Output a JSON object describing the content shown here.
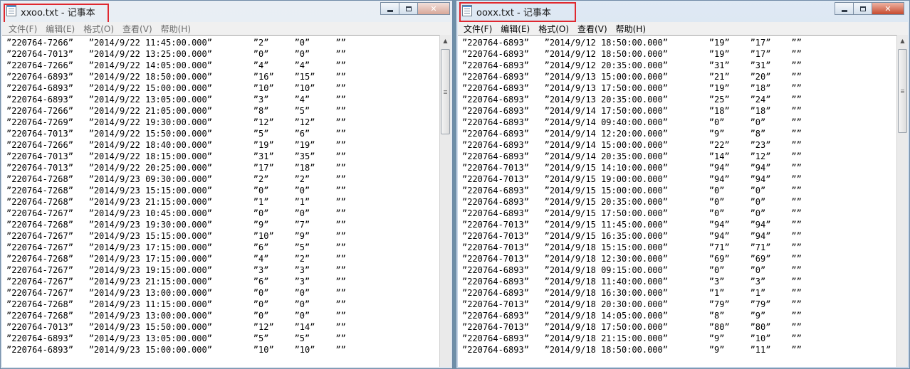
{
  "windows": [
    {
      "title": "xxoo.txt - 记事本",
      "menus": [
        "文件(F)",
        "编辑(E)",
        "格式(O)",
        "查看(V)",
        "帮助(H)"
      ],
      "rows": [
        [
          "220764-7266",
          "2014/9/22 11:45:00.000",
          "2",
          "0",
          ""
        ],
        [
          "220764-7013",
          "2014/9/22 13:25:00.000",
          "0",
          "0",
          ""
        ],
        [
          "220764-7266",
          "2014/9/22 14:05:00.000",
          "4",
          "4",
          ""
        ],
        [
          "220764-6893",
          "2014/9/22 18:50:00.000",
          "16",
          "15",
          ""
        ],
        [
          "220764-6893",
          "2014/9/22 15:00:00.000",
          "10",
          "10",
          ""
        ],
        [
          "220764-6893",
          "2014/9/22 13:05:00.000",
          "3",
          "4",
          ""
        ],
        [
          "220764-7266",
          "2014/9/22 21:05:00.000",
          "8",
          "5",
          ""
        ],
        [
          "220764-7269",
          "2014/9/22 19:30:00.000",
          "12",
          "12",
          ""
        ],
        [
          "220764-7013",
          "2014/9/22 15:50:00.000",
          "5",
          "6",
          ""
        ],
        [
          "220764-7266",
          "2014/9/22 18:40:00.000",
          "19",
          "19",
          ""
        ],
        [
          "220764-7013",
          "2014/9/22 18:15:00.000",
          "31",
          "35",
          ""
        ],
        [
          "220764-7013",
          "2014/9/22 20:25:00.000",
          "17",
          "18",
          ""
        ],
        [
          "220764-7268",
          "2014/9/23 09:30:00.000",
          "2",
          "2",
          ""
        ],
        [
          "220764-7268",
          "2014/9/23 15:15:00.000",
          "0",
          "0",
          ""
        ],
        [
          "220764-7268",
          "2014/9/23 21:15:00.000",
          "1",
          "1",
          ""
        ],
        [
          "220764-7267",
          "2014/9/23 10:45:00.000",
          "0",
          "0",
          ""
        ],
        [
          "220764-7268",
          "2014/9/23 19:30:00.000",
          "9",
          "7",
          ""
        ],
        [
          "220764-7267",
          "2014/9/23 15:15:00.000",
          "10",
          "9",
          ""
        ],
        [
          "220764-7267",
          "2014/9/23 17:15:00.000",
          "6",
          "5",
          ""
        ],
        [
          "220764-7268",
          "2014/9/23 17:15:00.000",
          "4",
          "2",
          ""
        ],
        [
          "220764-7267",
          "2014/9/23 19:15:00.000",
          "3",
          "3",
          ""
        ],
        [
          "220764-7267",
          "2014/9/23 21:15:00.000",
          "6",
          "3",
          ""
        ],
        [
          "220764-7267",
          "2014/9/23 13:00:00.000",
          "0",
          "0",
          ""
        ],
        [
          "220764-7268",
          "2014/9/23 11:15:00.000",
          "0",
          "0",
          ""
        ],
        [
          "220764-7268",
          "2014/9/23 13:00:00.000",
          "0",
          "0",
          ""
        ],
        [
          "220764-7013",
          "2014/9/23 15:50:00.000",
          "12",
          "14",
          ""
        ],
        [
          "220764-6893",
          "2014/9/23 13:05:00.000",
          "5",
          "5",
          ""
        ],
        [
          "220764-6893",
          "2014/9/23 15:00:00.000",
          "10",
          "10",
          ""
        ]
      ]
    },
    {
      "title": "ooxx.txt - 记事本",
      "menus": [
        "文件(F)",
        "编辑(E)",
        "格式(O)",
        "查看(V)",
        "帮助(H)"
      ],
      "rows": [
        [
          "220764-6893",
          "2014/9/12 18:50:00.000",
          "19",
          "17",
          ""
        ],
        [
          "220764-6893",
          "2014/9/12 18:50:00.000",
          "19",
          "17",
          ""
        ],
        [
          "220764-6893",
          "2014/9/12 20:35:00.000",
          "31",
          "31",
          ""
        ],
        [
          "220764-6893",
          "2014/9/13 15:00:00.000",
          "21",
          "20",
          ""
        ],
        [
          "220764-6893",
          "2014/9/13 17:50:00.000",
          "19",
          "18",
          ""
        ],
        [
          "220764-6893",
          "2014/9/13 20:35:00.000",
          "25",
          "24",
          ""
        ],
        [
          "220764-6893",
          "2014/9/14 17:50:00.000",
          "18",
          "18",
          ""
        ],
        [
          "220764-6893",
          "2014/9/14 09:40:00.000",
          "0",
          "0",
          ""
        ],
        [
          "220764-6893",
          "2014/9/14 12:20:00.000",
          "9",
          "8",
          ""
        ],
        [
          "220764-6893",
          "2014/9/14 15:00:00.000",
          "22",
          "23",
          ""
        ],
        [
          "220764-6893",
          "2014/9/14 20:35:00.000",
          "14",
          "12",
          ""
        ],
        [
          "220764-7013",
          "2014/9/15 14:10:00.000",
          "94",
          "94",
          ""
        ],
        [
          "220764-7013",
          "2014/9/15 19:00:00.000",
          "94",
          "94",
          ""
        ],
        [
          "220764-6893",
          "2014/9/15 15:00:00.000",
          "0",
          "0",
          ""
        ],
        [
          "220764-6893",
          "2014/9/15 20:35:00.000",
          "0",
          "0",
          ""
        ],
        [
          "220764-6893",
          "2014/9/15 17:50:00.000",
          "0",
          "0",
          ""
        ],
        [
          "220764-7013",
          "2014/9/15 11:45:00.000",
          "94",
          "94",
          ""
        ],
        [
          "220764-7013",
          "2014/9/15 16:35:00.000",
          "94",
          "94",
          ""
        ],
        [
          "220764-7013",
          "2014/9/18 15:15:00.000",
          "71",
          "71",
          ""
        ],
        [
          "220764-7013",
          "2014/9/18 12:30:00.000",
          "69",
          "69",
          ""
        ],
        [
          "220764-6893",
          "2014/9/18 09:15:00.000",
          "0",
          "0",
          ""
        ],
        [
          "220764-6893",
          "2014/9/18 11:40:00.000",
          "3",
          "3",
          ""
        ],
        [
          "220764-6893",
          "2014/9/18 16:30:00.000",
          "1",
          "1",
          ""
        ],
        [
          "220764-7013",
          "2014/9/18 20:30:00.000",
          "79",
          "79",
          ""
        ],
        [
          "220764-6893",
          "2014/9/18 14:05:00.000",
          "8",
          "9",
          ""
        ],
        [
          "220764-7013",
          "2014/9/18 17:50:00.000",
          "80",
          "80",
          ""
        ],
        [
          "220764-6893",
          "2014/9/18 21:15:00.000",
          "9",
          "10",
          ""
        ],
        [
          "220764-6893",
          "2014/9/18 18:50:00.000",
          "9",
          "11",
          ""
        ]
      ]
    }
  ]
}
